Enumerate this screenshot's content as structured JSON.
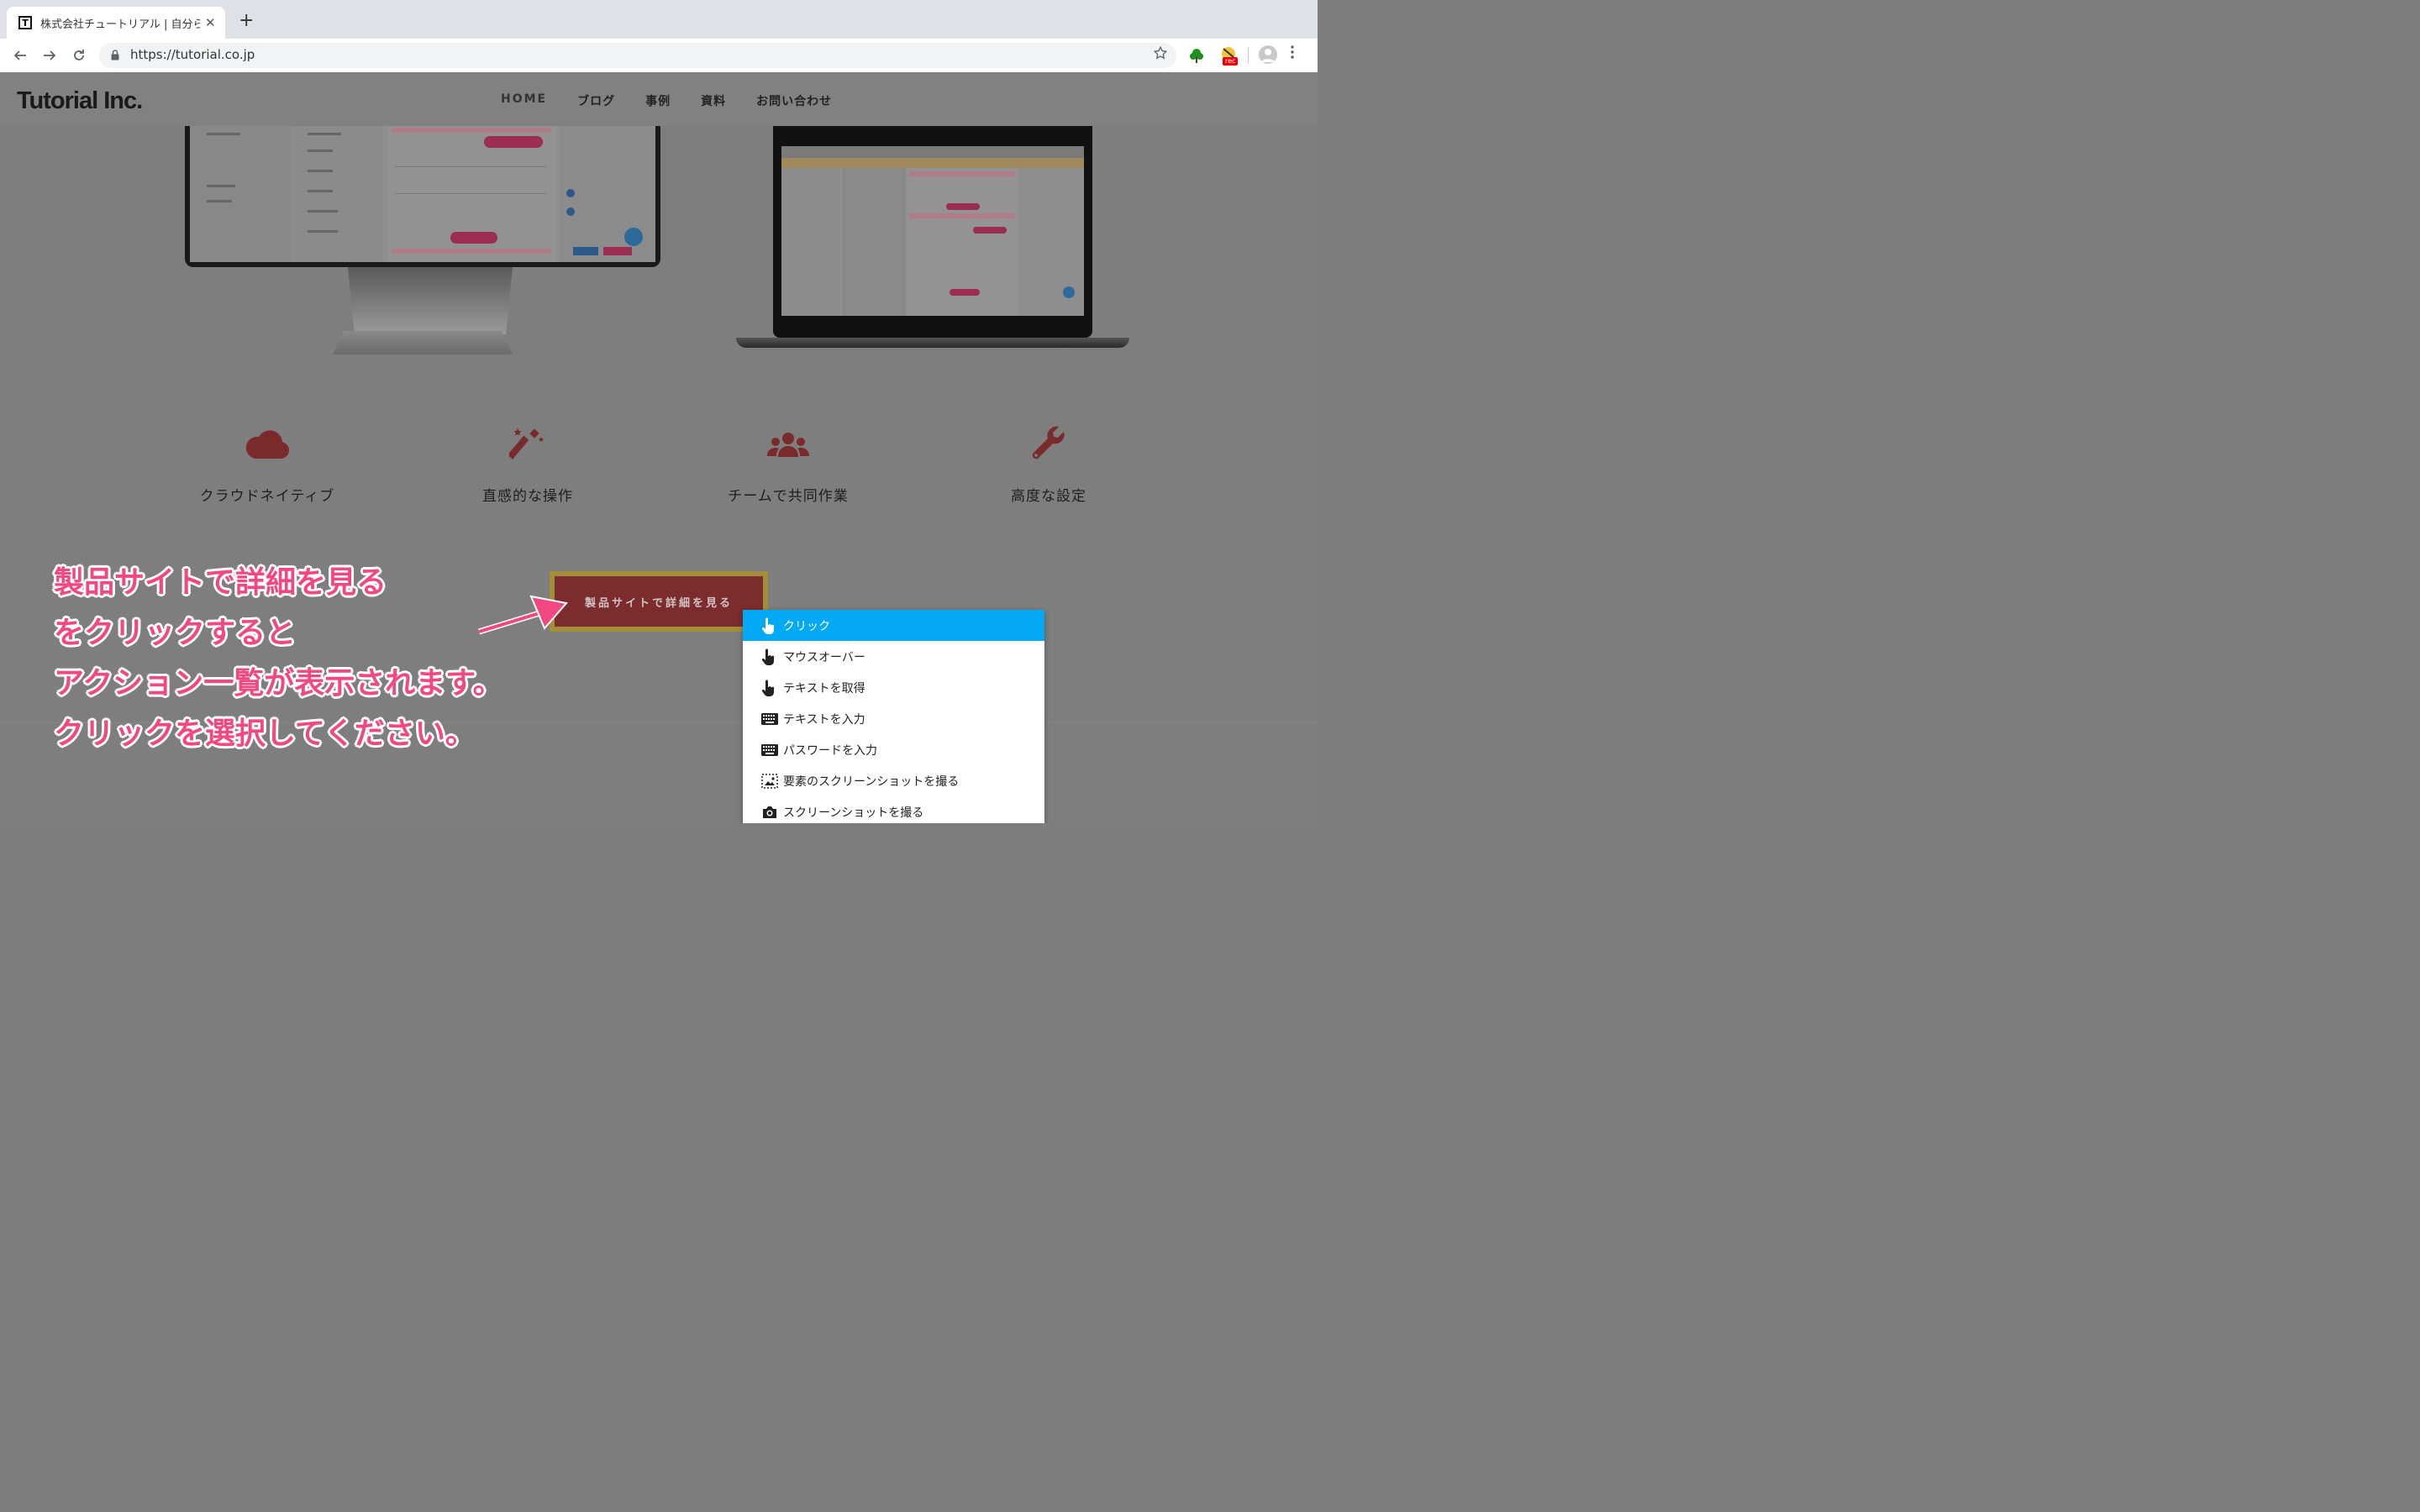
{
  "browser": {
    "tab_favicon": "T",
    "tab_title": "株式会社チュートリアル | 自分らしく",
    "tab_close": "✕",
    "new_tab": "+",
    "url": "https://tutorial.co.jp",
    "ext_rec_label": "rec"
  },
  "site": {
    "logo": "Tutorial Inc.",
    "nav": [
      "HOME",
      "ブログ",
      "事例",
      "資料",
      "お問い合わせ"
    ]
  },
  "features": [
    {
      "icon": "cloud-icon",
      "label": "クラウドネイティブ"
    },
    {
      "icon": "magic-wand-icon",
      "label": "直感的な操作"
    },
    {
      "icon": "users-icon",
      "label": "チームで共同作業"
    },
    {
      "icon": "wrench-icon",
      "label": "高度な設定"
    }
  ],
  "cta": {
    "label": "製品サイトで詳細を見る"
  },
  "annotation": {
    "lines": [
      "製品サイトで詳細を見る",
      "をクリックすると",
      "アクション一覧が表示されます。",
      "クリックを選択してください。"
    ]
  },
  "action_menu": {
    "items": [
      {
        "icon": "pointer-hand-icon",
        "label": "クリック",
        "active": true
      },
      {
        "icon": "pointer-hand-icon",
        "label": "マウスオーバー",
        "active": false
      },
      {
        "icon": "pointer-hand-icon",
        "label": "テキストを取得",
        "active": false
      },
      {
        "icon": "keyboard-icon",
        "label": "テキストを入力",
        "active": false
      },
      {
        "icon": "keyboard-icon",
        "label": "パスワードを入力",
        "active": false
      },
      {
        "icon": "element-screenshot-icon",
        "label": "要素のスクリーンショットを撮る",
        "active": false
      },
      {
        "icon": "camera-icon",
        "label": "スクリーンショットを撮る",
        "active": false
      }
    ]
  },
  "colors": {
    "menu_active": "#03a9f4",
    "annotation_text": "#f24780",
    "feature_icon": "#7a2a2a",
    "cta_bg": "#7c2c2c",
    "cta_highlight": "#a48d38"
  }
}
